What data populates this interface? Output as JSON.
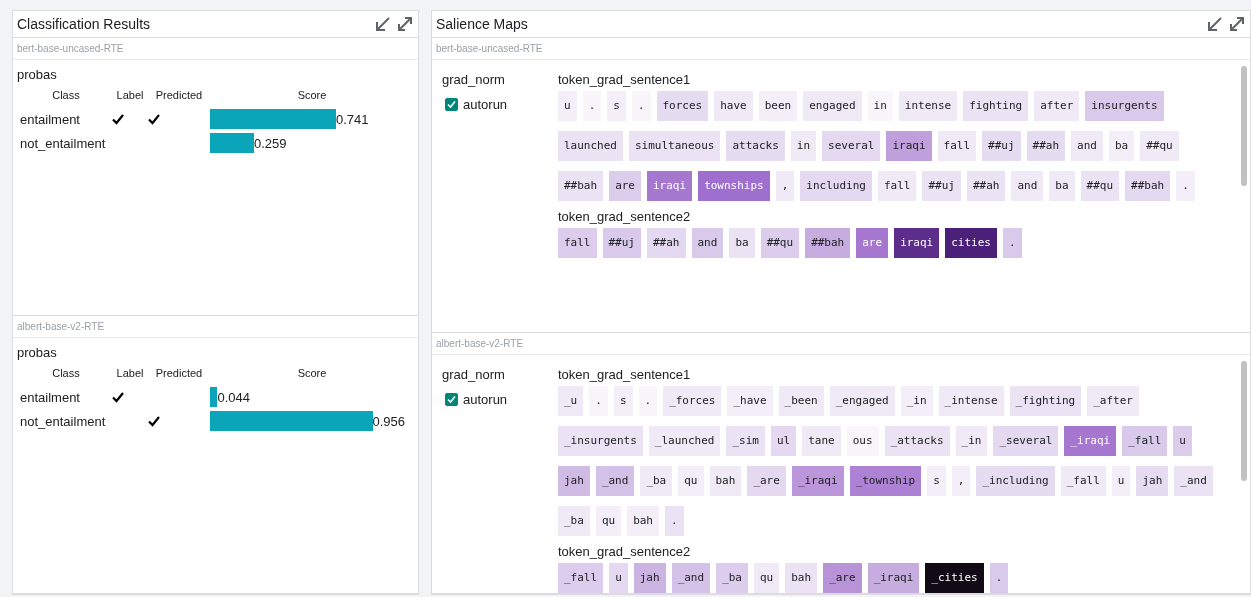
{
  "classification": {
    "title": "Classification Results",
    "models": [
      {
        "name": "bert-base-uncased-RTE",
        "field": "probas",
        "columns": [
          "Class",
          "Label",
          "Predicted",
          "Score"
        ],
        "rows": [
          {
            "class": "entailment",
            "label": true,
            "predicted": true,
            "score": "0.741"
          },
          {
            "class": "not_entailment",
            "label": false,
            "predicted": false,
            "score": "0.259"
          }
        ]
      },
      {
        "name": "albert-base-v2-RTE",
        "field": "probas",
        "columns": [
          "Class",
          "Label",
          "Predicted",
          "Score"
        ],
        "rows": [
          {
            "class": "entailment",
            "label": true,
            "predicted": false,
            "score": "0.044"
          },
          {
            "class": "not_entailment",
            "label": false,
            "predicted": true,
            "score": "0.956"
          }
        ]
      }
    ]
  },
  "salience": {
    "title": "Salience Maps",
    "models": [
      {
        "name": "bert-base-uncased-RTE",
        "method": "grad_norm",
        "autorun": {
          "label": "autorun",
          "checked": true
        },
        "fields": [
          {
            "name": "token_grad_sentence1",
            "tokens": [
              {
                "text": "u",
                "color": "#f3eef8"
              },
              {
                "text": ".",
                "color": "#f8f5fb"
              },
              {
                "text": "s",
                "color": "#f3eef8"
              },
              {
                "text": ".",
                "color": "#f8f5fb"
              },
              {
                "text": "forces",
                "color": "#e6dcf1"
              },
              {
                "text": "have",
                "color": "#f0eaf6"
              },
              {
                "text": "been",
                "color": "#f3eef8"
              },
              {
                "text": "engaged",
                "color": "#f0eaf6"
              },
              {
                "text": "in",
                "color": "#f8f5fb"
              },
              {
                "text": "intense",
                "color": "#f0eaf6"
              },
              {
                "text": "fighting",
                "color": "#ebe3f4"
              },
              {
                "text": "after",
                "color": "#f0eaf6"
              },
              {
                "text": "insurgents",
                "color": "#d9c9ea"
              },
              {
                "text": "launched",
                "color": "#ebe3f4"
              },
              {
                "text": "simultaneous",
                "color": "#ebe3f4"
              },
              {
                "text": "attacks",
                "color": "#e6dcf1"
              },
              {
                "text": "in",
                "color": "#f0eaf6"
              },
              {
                "text": "several",
                "color": "#e4d9f0"
              },
              {
                "text": "iraqi",
                "color": "#c0a0dc"
              },
              {
                "text": "fall",
                "color": "#f0eaf6"
              },
              {
                "text": "##uj",
                "color": "#e6dcf1"
              },
              {
                "text": "##ah",
                "color": "#e6dcf1"
              },
              {
                "text": "and",
                "color": "#f0eaf6"
              },
              {
                "text": "ba",
                "color": "#f3eef8"
              },
              {
                "text": "##qu",
                "color": "#f0eaf6"
              },
              {
                "text": "##bah",
                "color": "#ebe3f4"
              },
              {
                "text": "are",
                "color": "#dccdec"
              },
              {
                "text": "iraqi",
                "color": "#a677cf"
              },
              {
                "text": "townships",
                "color": "#9f6fcf"
              },
              {
                "text": ",",
                "color": "#f0eaf6"
              },
              {
                "text": "including",
                "color": "#e4d9f0"
              },
              {
                "text": "fall",
                "color": "#f0eaf6"
              },
              {
                "text": "##uj",
                "color": "#ebe3f4"
              },
              {
                "text": "##ah",
                "color": "#ebe3f4"
              },
              {
                "text": "and",
                "color": "#f0eaf6"
              },
              {
                "text": "ba",
                "color": "#f0eaf6"
              },
              {
                "text": "##qu",
                "color": "#ebe3f4"
              },
              {
                "text": "##bah",
                "color": "#e4d9f0"
              },
              {
                "text": ".",
                "color": "#f3eef8"
              }
            ]
          },
          {
            "name": "token_grad_sentence2",
            "tokens": [
              {
                "text": "fall",
                "color": "#dccdec"
              },
              {
                "text": "##uj",
                "color": "#d9c9ea"
              },
              {
                "text": "##ah",
                "color": "#e4d9f0"
              },
              {
                "text": "and",
                "color": "#d9c9ea"
              },
              {
                "text": "ba",
                "color": "#ebe3f4"
              },
              {
                "text": "##qu",
                "color": "#dccdec"
              },
              {
                "text": "##bah",
                "color": "#c7addf"
              },
              {
                "text": "are",
                "color": "#a677cf"
              },
              {
                "text": "iraqi",
                "color": "#5c2d8a"
              },
              {
                "text": "cities",
                "color": "#4b2078"
              },
              {
                "text": ".",
                "color": "#d9c9ea"
              }
            ]
          }
        ]
      },
      {
        "name": "albert-base-v2-RTE",
        "method": "grad_norm",
        "autorun": {
          "label": "autorun",
          "checked": true
        },
        "fields": [
          {
            "name": "token_grad_sentence1",
            "tokens": [
              {
                "text": "_u",
                "color": "#f0eaf6"
              },
              {
                "text": ".",
                "color": "#f8f5fb"
              },
              {
                "text": "s",
                "color": "#f3eef8"
              },
              {
                "text": ".",
                "color": "#f8f5fb"
              },
              {
                "text": "_forces",
                "color": "#f0eaf6"
              },
              {
                "text": "_have",
                "color": "#f3eef8"
              },
              {
                "text": "_been",
                "color": "#f0eaf6"
              },
              {
                "text": "_engaged",
                "color": "#f0eaf6"
              },
              {
                "text": "_in",
                "color": "#f3eef8"
              },
              {
                "text": "_intense",
                "color": "#f0eaf6"
              },
              {
                "text": "_fighting",
                "color": "#ebe3f4"
              },
              {
                "text": "_after",
                "color": "#f0eaf6"
              },
              {
                "text": "_insurgents",
                "color": "#ebe3f4"
              },
              {
                "text": "_launched",
                "color": "#f0eaf6"
              },
              {
                "text": "_sim",
                "color": "#ebe3f4"
              },
              {
                "text": "ul",
                "color": "#e4d9f0"
              },
              {
                "text": "tane",
                "color": "#f0eaf6"
              },
              {
                "text": "ous",
                "color": "#f8f5fb"
              },
              {
                "text": "_attacks",
                "color": "#ebe3f4"
              },
              {
                "text": "_in",
                "color": "#f0eaf6"
              },
              {
                "text": "_several",
                "color": "#e4d9f0"
              },
              {
                "text": "_iraqi",
                "color": "#a677cf"
              },
              {
                "text": "_fall",
                "color": "#d9c9ea"
              },
              {
                "text": "u",
                "color": "#dccdec"
              },
              {
                "text": "jah",
                "color": "#d0bbe5"
              },
              {
                "text": "_and",
                "color": "#d4c1e7"
              },
              {
                "text": "_ba",
                "color": "#f0eaf6"
              },
              {
                "text": "qu",
                "color": "#f3eef8"
              },
              {
                "text": "bah",
                "color": "#f0eaf6"
              },
              {
                "text": "_are",
                "color": "#e4d9f0"
              },
              {
                "text": "_iraqi",
                "color": "#bb96da"
              },
              {
                "text": "_township",
                "color": "#ad82d4"
              },
              {
                "text": "s",
                "color": "#f3eef8"
              },
              {
                "text": ",",
                "color": "#f3eef8"
              },
              {
                "text": "_including",
                "color": "#e6dcf1"
              },
              {
                "text": "_fall",
                "color": "#f0eaf6"
              },
              {
                "text": "u",
                "color": "#f3eef8"
              },
              {
                "text": "jah",
                "color": "#e6dcf1"
              },
              {
                "text": "_and",
                "color": "#ebe3f4"
              },
              {
                "text": "_ba",
                "color": "#f0eaf6"
              },
              {
                "text": "qu",
                "color": "#f3eef8"
              },
              {
                "text": "bah",
                "color": "#f3eef8"
              },
              {
                "text": ".",
                "color": "#ebe3f4"
              }
            ]
          },
          {
            "name": "token_grad_sentence2",
            "tokens": [
              {
                "text": "_fall",
                "color": "#dccdec"
              },
              {
                "text": "u",
                "color": "#e4d9f0"
              },
              {
                "text": "jah",
                "color": "#cbb4e2"
              },
              {
                "text": "_and",
                "color": "#d4c1e7"
              },
              {
                "text": "_ba",
                "color": "#dccdec"
              },
              {
                "text": "qu",
                "color": "#f0eaf6"
              },
              {
                "text": "bah",
                "color": "#ebe3f4"
              },
              {
                "text": "_are",
                "color": "#b893d8"
              },
              {
                "text": "_iraqi",
                "color": "#c7addf"
              },
              {
                "text": "_cities",
                "color": "#120a14"
              },
              {
                "text": ".",
                "color": "#d9c9ea"
              }
            ]
          }
        ]
      }
    ]
  }
}
